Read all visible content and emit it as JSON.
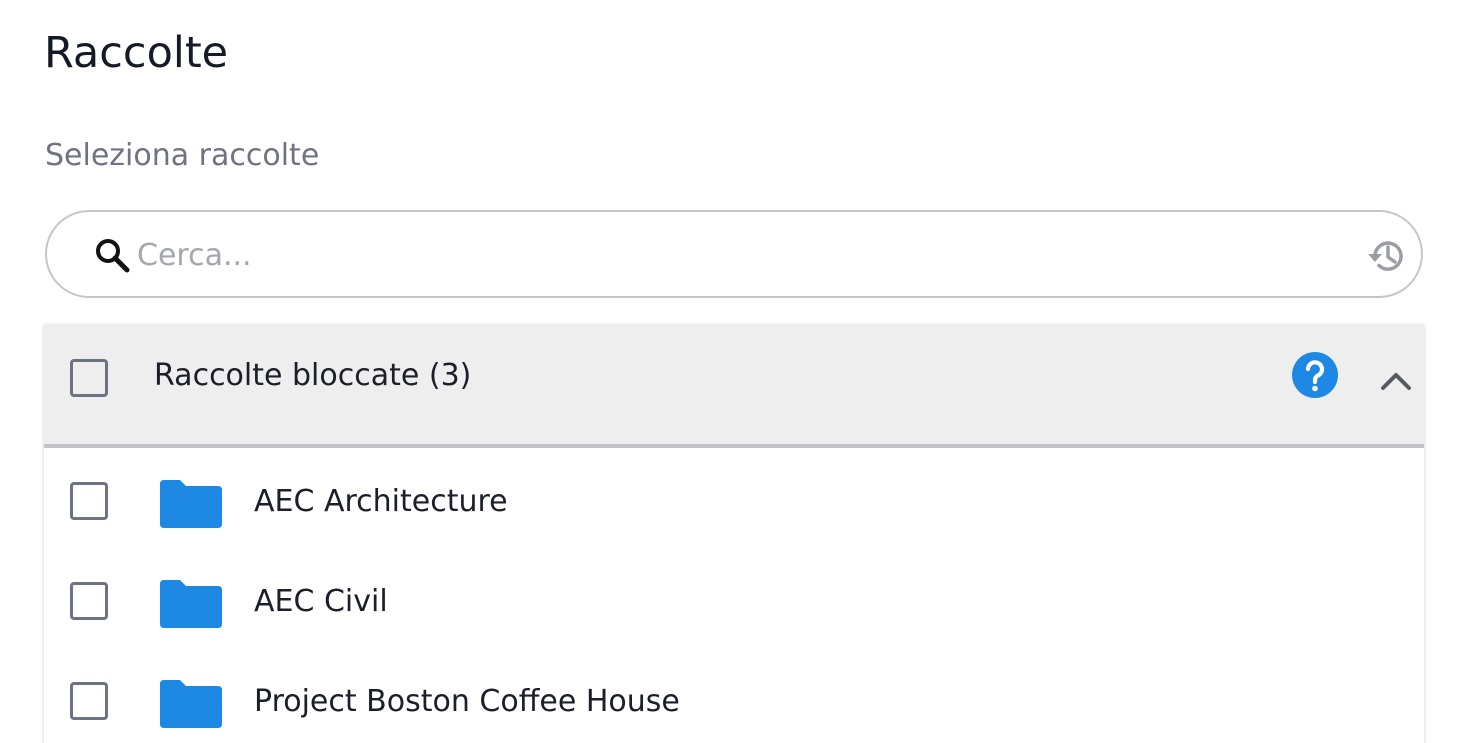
{
  "header": {
    "title": "Raccolte",
    "subtitle": "Seleziona raccolte"
  },
  "search": {
    "placeholder": "Cerca...",
    "value": ""
  },
  "group": {
    "label": "Raccolte bloccate (3)",
    "expanded": true,
    "items": [
      {
        "label": "AEC Architecture"
      },
      {
        "label": "AEC Civil"
      },
      {
        "label": "Project Boston Coffee House"
      }
    ]
  },
  "colors": {
    "accent": "#1e88e5",
    "folder": "#1e88e5",
    "header_bg": "#eeeeee"
  },
  "icons": {
    "search": "search-icon",
    "history": "history-icon",
    "help": "help-icon",
    "collapse": "chevron-up-icon",
    "folder": "folder-icon"
  }
}
